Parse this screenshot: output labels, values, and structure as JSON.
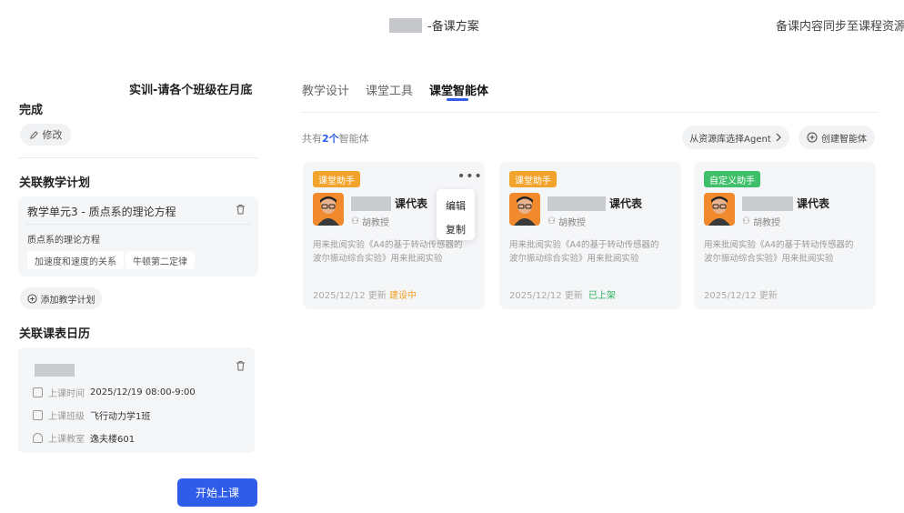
{
  "header": {
    "title_suffix": "-备课方案",
    "sync_text": "备课内容同步至课程资源"
  },
  "left": {
    "task_line1": "实训-请各个班级在月底",
    "task_line2": "完成",
    "edit_label": "修改",
    "plan_section_title": "关联教学计划",
    "plan_card": {
      "title": "教学单元3 - 质点系的理论方程",
      "subtitle": "质点系的理论方程",
      "chips": [
        "加速度和速度的关系",
        "牛顿第二定律"
      ]
    },
    "add_plan_label": "添加教学计划",
    "calendar_section_title": "关联课表日历",
    "calendar_card": {
      "rows": [
        {
          "label": "上课时间",
          "value": "2025/12/19 08:00-9:00",
          "icon": "clock-icon"
        },
        {
          "label": "上课班级",
          "value": "飞行动力学1班",
          "icon": "class-icon"
        },
        {
          "label": "上课教室",
          "value": "逸夫楼601",
          "icon": "room-icon"
        }
      ]
    },
    "start_button": "开始上课"
  },
  "tabs": [
    {
      "label": "教学设计",
      "active": false
    },
    {
      "label": "课堂工具",
      "active": false
    },
    {
      "label": "课堂智能体",
      "active": true
    }
  ],
  "agents_header": {
    "count_prefix": "共有",
    "count": "2个",
    "count_suffix": "智能体",
    "select_agent_label": "从资源库选择Agent",
    "create_agent_label": "创建智能体"
  },
  "agents": [
    {
      "badge": "课堂助手",
      "badge_color": "#f2a32c",
      "name_suffix": "课代表",
      "author": "胡教授",
      "description": "用来批阅实验《A4的基于转动传感器的波尔振动综合实验》用来批阅实验",
      "date": "2025/12/12 更新",
      "status": "建设中",
      "status_color": "#f0a020"
    },
    {
      "badge": "课堂助手",
      "badge_color": "#f2a32c",
      "name_suffix": "课代表",
      "author": "胡教授",
      "description": "用来批阅实验《A4的基于转动传感器的波尔振动综合实验》用来批阅实验",
      "date": "2025/12/12 更新",
      "status": "已上架",
      "status_color": "#27b05a"
    },
    {
      "badge": "自定义助手",
      "badge_color": "#3fbf6a",
      "name_suffix": "课代表",
      "author": "胡教授",
      "description": "用来批阅实验《A4的基于转动传感器的波尔振动综合实验》用来批阅实验",
      "date": "2025/12/12 更新",
      "status": "",
      "status_color": "#999999"
    }
  ],
  "card_menu": {
    "items": [
      "编辑",
      "复制"
    ]
  },
  "colors": {
    "accent": "#2f5ce9"
  }
}
